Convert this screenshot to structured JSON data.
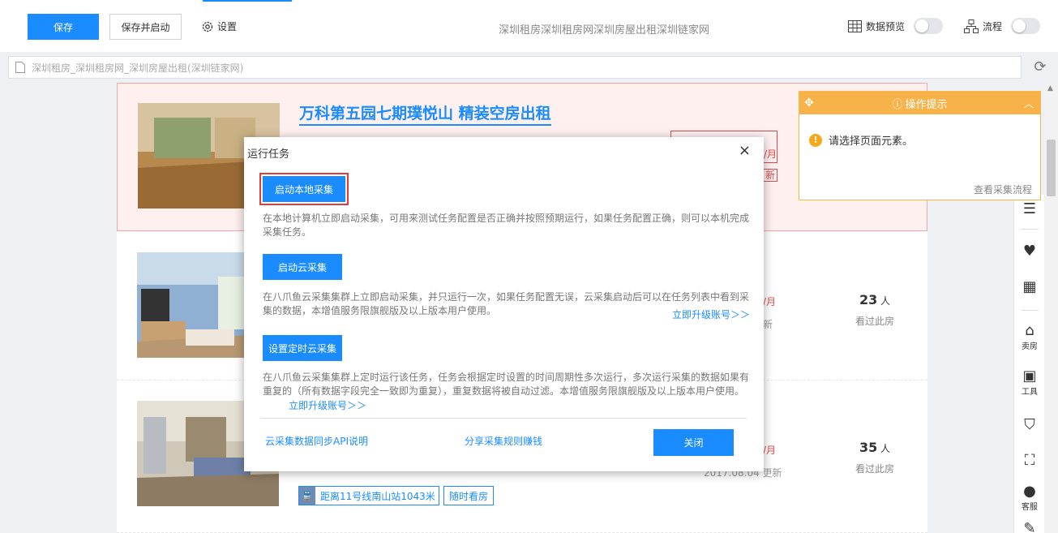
{
  "toolbar": {
    "save": "保存",
    "save_and_start": "保存并启动",
    "settings": "设置",
    "page_title": "深圳租房深圳租房网深圳房屋出租深圳链家网",
    "data_preview": "数据预览",
    "flow": "流程"
  },
  "addressbar": {
    "url": "深圳租房_深圳租房网_深圳房屋出租(深圳链家网)"
  },
  "listings": [
    {
      "title": "万科第五园七期璞悦山 精装空房出租",
      "price_tail": "/月",
      "tag": "新"
    },
    {
      "price_tail": "/月",
      "tag": "新",
      "view_count": "23",
      "view_unit": "人",
      "view_label": "看过此房"
    },
    {
      "price_tail": "/月",
      "date": "2017.08.04 更新",
      "view_count": "35",
      "view_unit": "人",
      "view_label": "看过此房",
      "metro_icon": "🚆",
      "metro": "距离11号线南山站1043米",
      "visit": "随时看房"
    }
  ],
  "hint": {
    "title": "操作提示",
    "message": "请选择页面元素。",
    "link": "查看采集流程"
  },
  "sidebar": {
    "sell_label": "卖房",
    "tools_label": "工具",
    "service_label": "客服"
  },
  "modal": {
    "title": "运行任务",
    "close_icon": "×",
    "local_btn": "启动本地采集",
    "local_desc": "在本地计算机立即启动采集，可用来测试任务配置是否正确并按照预期运行，如果任务配置正确，则可以本机完成采集任务。",
    "cloud_btn": "启动云采集",
    "cloud_desc": "在八爪鱼云采集集群上立即启动采集，并只运行一次，如果任务配置无误，云采集启动后可以在任务列表中看到采集的数据，本增值服务限旗舰版及以上版本用户使用。",
    "upgrade_link": "立即升级账号＞＞",
    "schedule_btn": "设置定时云采集",
    "schedule_desc": "在八爪鱼云采集集群上定时运行该任务，任务会根据定时设置的时间周期性多次运行，多次运行采集的数据如果有重复的（所有数据字段完全一致即为重复），重复数据将被自动过滤。本增值服务限旗舰版及以上版本用户使用。",
    "api_link": "云采集数据同步API说明",
    "share_link": "分享采集规则赚钱",
    "close_btn": "关闭"
  }
}
